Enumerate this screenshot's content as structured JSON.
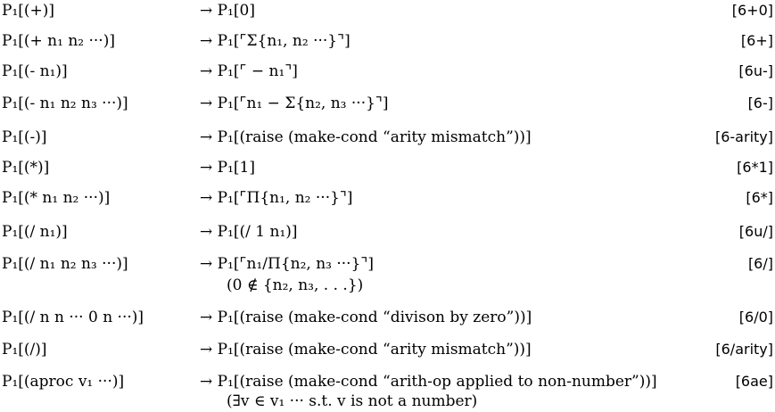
{
  "rules": [
    {
      "lhs": "P₁[(+)]",
      "rhs": "→ P₁[0]",
      "tag": "[6+0]"
    },
    {
      "lhs": "P₁[(+ n₁ n₂ ···)]",
      "rhs": "→ P₁[⌜Σ{n₁, n₂ ···}⌝]",
      "tag": "[6+]"
    },
    {
      "lhs": "P₁[(- n₁)]",
      "rhs": "→ P₁[⌜ − n₁⌝]",
      "tag": "[6u-]"
    },
    {
      "lhs": "P₁[(- n₁ n₂ n₃ ···)]",
      "rhs": "→ P₁[⌜n₁ − Σ{n₂, n₃ ···}⌝]",
      "tag": "[6-]"
    },
    {
      "lhs": "P₁[(-)]",
      "rhs": "→ P₁[(raise (make-cond “arity mismatch”))]",
      "tag": "[6-arity]"
    },
    {
      "lhs": "P₁[(*)]",
      "rhs": "→ P₁[1]",
      "tag": "[6*1]"
    },
    {
      "lhs": "P₁[(* n₁ n₂ ···)]",
      "rhs": "→ P₁[⌜Π{n₁, n₂ ···}⌝]",
      "tag": "[6*]"
    },
    {
      "lhs": "P₁[(/ n₁)]",
      "rhs": "→ P₁[(/ 1 n₁)]",
      "tag": "[6u/]"
    },
    {
      "lhs": "P₁[(/ n₁ n₂ n₃ ···)]",
      "rhs": "→ P₁[⌜n₁/Π{n₂, n₃ ···}⌝]",
      "tag": "[6/]",
      "side": "(0 ∉ {n₂, n₃, . . .})"
    },
    {
      "lhs": "P₁[(/ n n ··· 0 n ···)]",
      "rhs": "→ P₁[(raise (make-cond “divison by zero”))]",
      "tag": "[6/0]"
    },
    {
      "lhs": "P₁[(/)]",
      "rhs": "→ P₁[(raise (make-cond “arity mismatch”))]",
      "tag": "[6/arity]"
    },
    {
      "lhs": "P₁[(aproc v₁ ···)]",
      "rhs": "→ P₁[(raise (make-cond “arith-op applied to non-number”))]",
      "tag": "[6ae]",
      "side": "(∃v ∈ v₁ ··· s.t. v is not a number)"
    }
  ]
}
